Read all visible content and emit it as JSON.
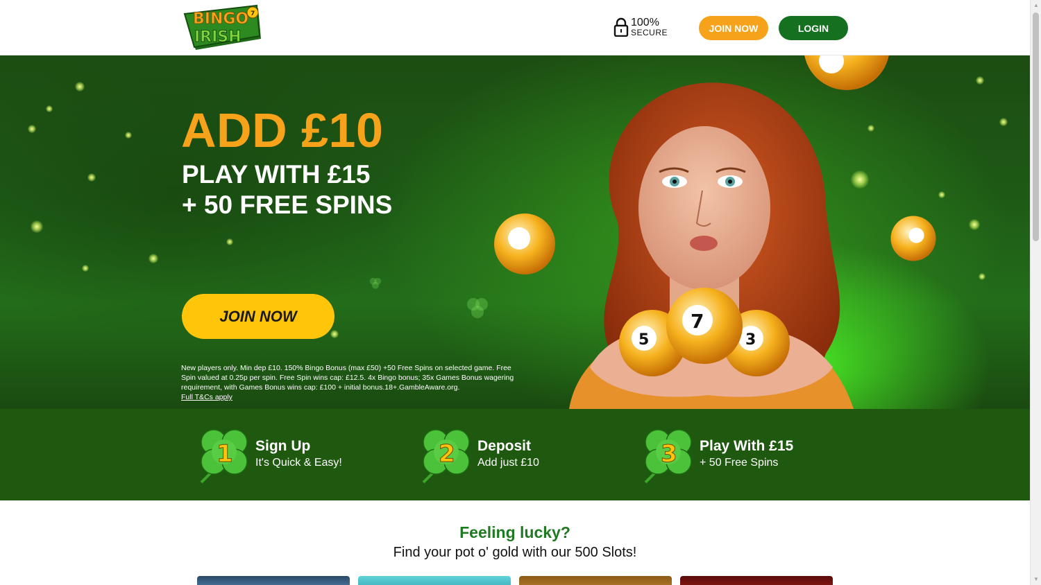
{
  "header": {
    "logo_text_top": "BINGO",
    "logo_text_bottom": "IRISH",
    "secure_percent": "100%",
    "secure_label": "SECURE",
    "join_label": "JOIN NOW",
    "login_label": "LOGIN"
  },
  "hero": {
    "headline": "ADD £10",
    "subline_1": "PLAY WITH £15",
    "subline_2": "+ 50 FREE SPINS",
    "cta_label": "JOIN NOW",
    "terms_text": "New players only. Min dep £10. 150% Bingo Bonus (max £50) +50 Free Spins on selected game. Free Spin valued at 0.25p per spin. Free Spin wins cap: £12.5. 4x Bingo bonus; 35x Games Bonus wagering requirement, with Games Bonus wins cap: £100 + initial bonus.18+.GambleAware.org.",
    "terms_link": "Full T&Cs apply",
    "ball_numbers": [
      "5",
      "7",
      "3"
    ]
  },
  "steps": [
    {
      "number": "1",
      "title": "Sign Up",
      "subtitle": "It's Quick & Easy!"
    },
    {
      "number": "2",
      "title": "Deposit",
      "subtitle": "Add just £10"
    },
    {
      "number": "3",
      "title": "Play With £15",
      "subtitle": "+ 50 Free Spins"
    }
  ],
  "lucky": {
    "title": "Feeling lucky?",
    "subtitle": "Find your pot o' gold with our 500 Slots!"
  },
  "colors": {
    "orange": "#f7a21b",
    "green_button": "#15711f",
    "yellow_cta": "#fec50a",
    "steps_bg": "#1f5910",
    "lucky_title": "#1f7a22"
  }
}
